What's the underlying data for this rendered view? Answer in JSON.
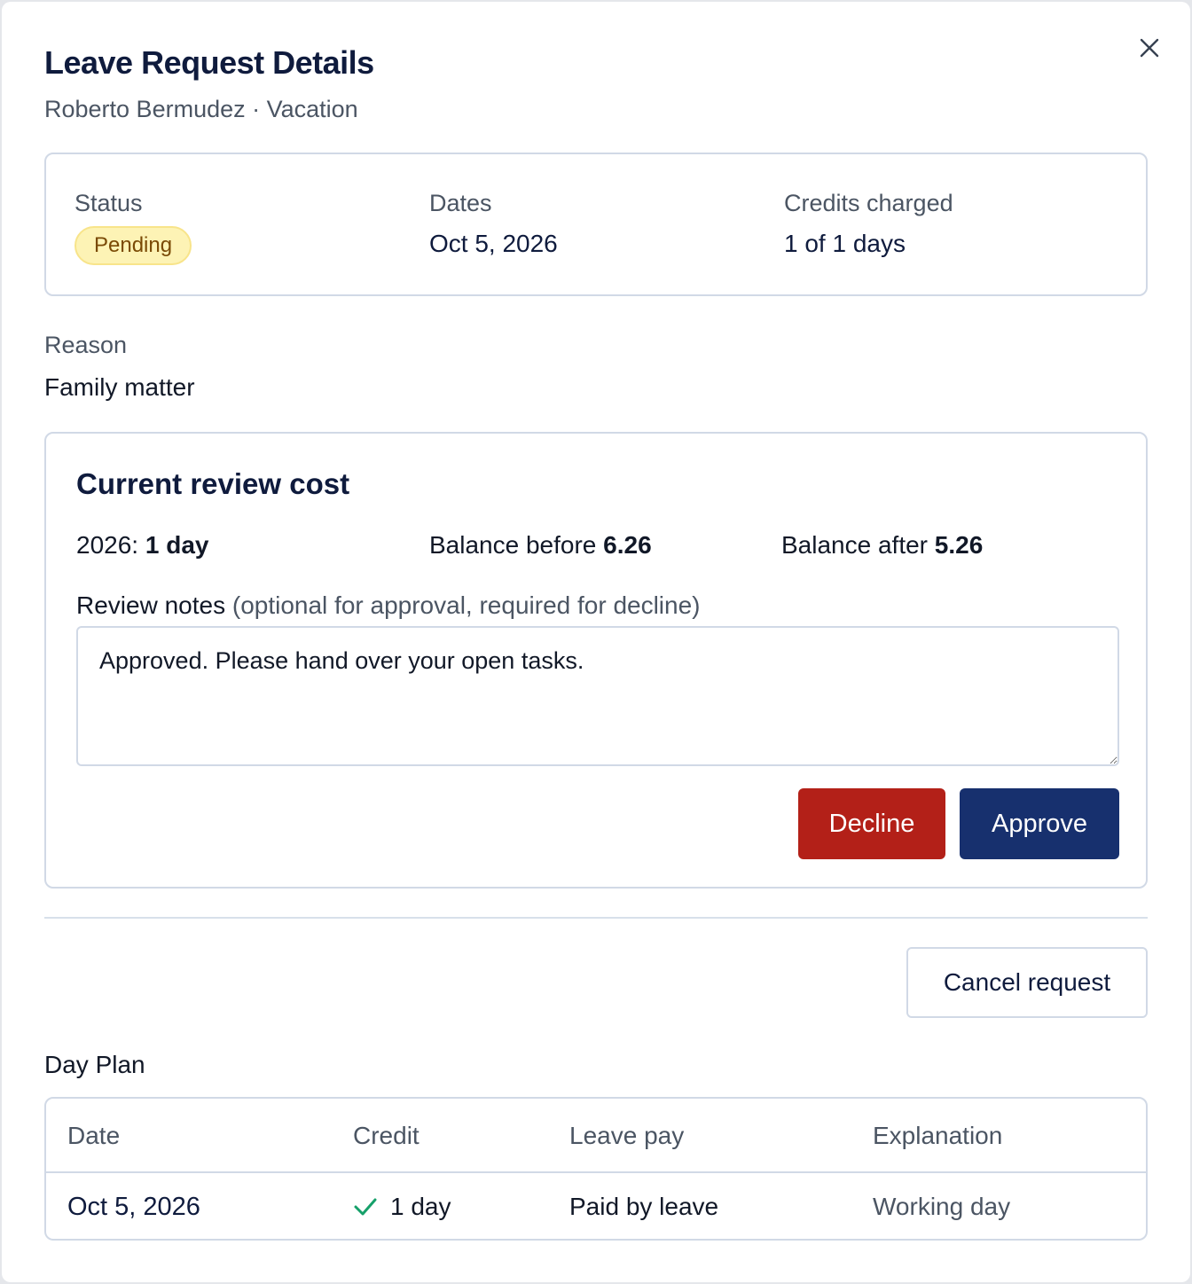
{
  "dialog": {
    "title": "Leave Request Details",
    "subtitle": "Roberto Bermudez · Vacation",
    "close_icon": "close-icon"
  },
  "summary": {
    "status_label": "Status",
    "status_value": "Pending",
    "status_color": "#fdf3b5",
    "dates_label": "Dates",
    "dates_value": "Oct 5, 2026",
    "credits_label": "Credits charged",
    "credits_value": "1 of 1 days"
  },
  "reason": {
    "label": "Reason",
    "value": "Family matter"
  },
  "review": {
    "title": "Current review cost",
    "year_prefix": "2026:",
    "year_value": "1 day",
    "balance_before_label": "Balance before",
    "balance_before_value": "6.26",
    "balance_after_label": "Balance after",
    "balance_after_value": "5.26",
    "notes_label": "Review notes",
    "notes_hint": "(optional for approval, required for decline)",
    "notes_value": "Approved. Please hand over your open tasks.",
    "decline_label": "Decline",
    "decline_color": "#b32018",
    "approve_label": "Approve",
    "approve_color": "#17306e"
  },
  "actions": {
    "cancel_label": "Cancel request"
  },
  "day_plan": {
    "title": "Day Plan",
    "columns": [
      "Date",
      "Credit",
      "Leave pay",
      "Explanation"
    ],
    "rows": [
      {
        "date": "Oct 5, 2026",
        "credit_icon": "check-icon",
        "credit": "1 day",
        "leave_pay": "Paid by leave",
        "explanation": "Working day"
      }
    ]
  }
}
